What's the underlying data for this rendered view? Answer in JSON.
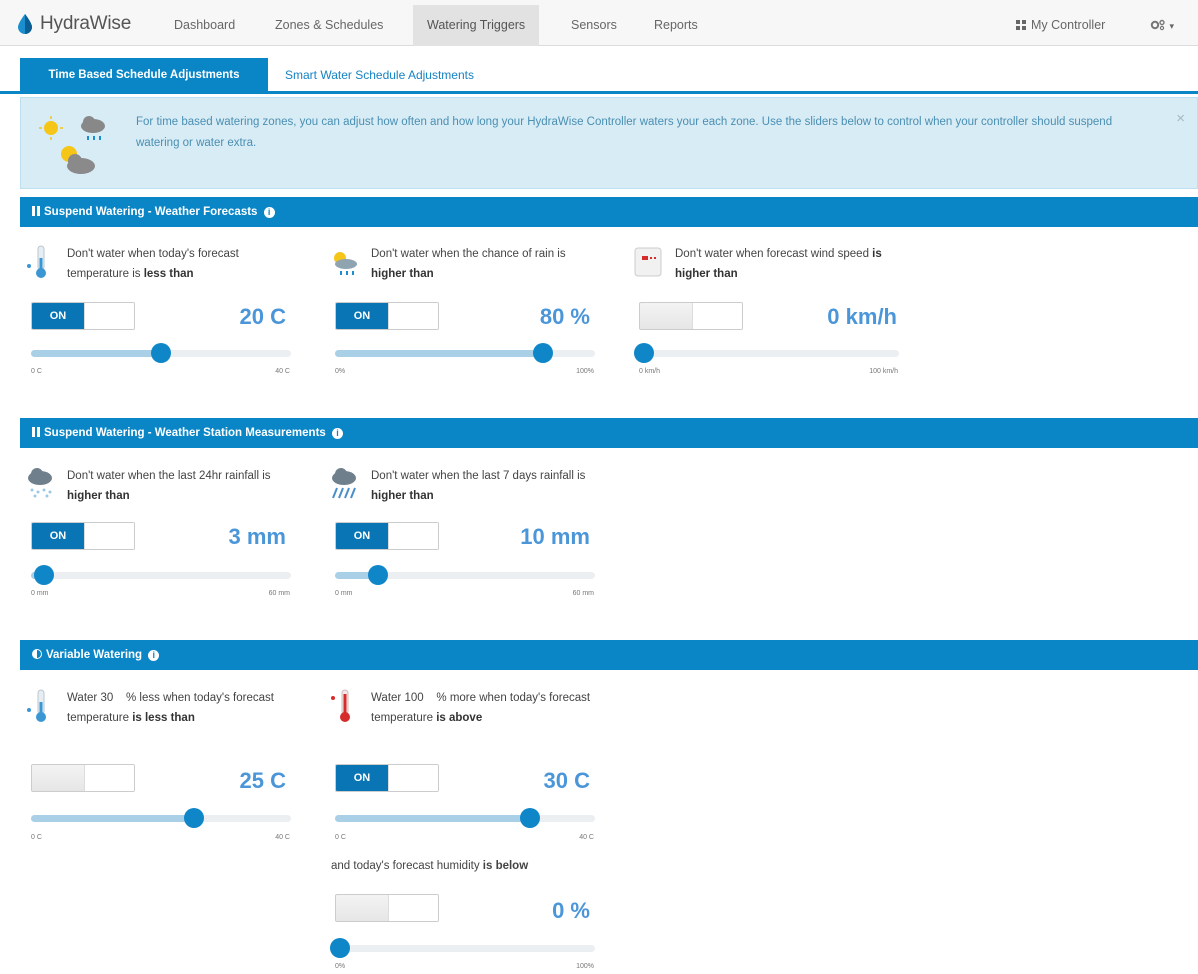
{
  "brand": {
    "name": "HydraWise"
  },
  "nav": {
    "items": [
      "Dashboard",
      "Zones & Schedules",
      "Watering Triggers",
      "Sensors",
      "Reports"
    ],
    "controller": "My Controller",
    "settings_caret": "▾"
  },
  "tabs": [
    "Time Based Schedule Adjustments",
    "Smart Water Schedule Adjustments"
  ],
  "info": {
    "text": "For time based watering zones, you can adjust how often and how long your HydraWise Controller waters your each zone. Use the sliders below to control when your controller should suspend watering or water extra.",
    "close": "×"
  },
  "sections": {
    "forecast": "Suspend Watering - Weather Forecasts",
    "station": "Suspend Watering - Weather Station Measurements",
    "variable": "Variable Watering"
  },
  "toggle_on": "ON",
  "colors": {
    "accent": "#0a86c6",
    "value": "#4b96d9",
    "slider_fill": "#a9d0e6",
    "info_bg": "#d8ecf6"
  },
  "cards": {
    "temp": {
      "icon": "thermometer-cold-icon",
      "pre": "Don't water when today's forecast temperature is ",
      "bold": "less than",
      "value": "20 C",
      "on": true,
      "level": 0.5,
      "min": "0 C",
      "max": "40 C"
    },
    "rain": {
      "icon": "sun-cloud-rain-icon",
      "pre": "Don't water when the chance of rain is ",
      "bold": "higher than",
      "value": "80 %",
      "on": true,
      "level": 0.8,
      "min": "0%",
      "max": "100%"
    },
    "wind": {
      "icon": "wind-flag-icon",
      "pre": "Don't water when forecast wind speed ",
      "bold": "is higher than",
      "value": "0 km/h",
      "on": false,
      "level": 0.0,
      "min": "0 km/h",
      "max": "100 km/h"
    },
    "rain24": {
      "icon": "rain-cloud-icon",
      "pre": "Don't water when the last 24hr rainfall is ",
      "bold": "higher than",
      "value": "3 mm",
      "on": true,
      "level": 0.05,
      "min": "0 mm",
      "max": "60 mm"
    },
    "rain7": {
      "icon": "heavy-rain-cloud-icon",
      "pre": "Don't water when the last 7 days rainfall is ",
      "bold": "higher than",
      "value": "10 mm",
      "on": true,
      "level": 0.167,
      "min": "0 mm",
      "max": "60 mm"
    },
    "varcold": {
      "icon": "thermometer-cold-icon",
      "pre": "Water 30    % less when today's forecast temperature ",
      "bold": "is less than",
      "value": "25 C",
      "on": false,
      "level": 0.625,
      "min": "0 C",
      "max": "40 C"
    },
    "varhot": {
      "icon": "thermometer-hot-icon",
      "pre": "Water 100    % more when today's forecast temperature ",
      "bold": "is above",
      "value": "30 C",
      "on": true,
      "level": 0.75,
      "min": "0 C",
      "max": "40 C"
    },
    "humidity": {
      "pre": "and today's forecast humidity ",
      "bold": "is below",
      "value": "0 %",
      "on": false,
      "level": 0.0,
      "min": "0%",
      "max": "100%"
    }
  }
}
